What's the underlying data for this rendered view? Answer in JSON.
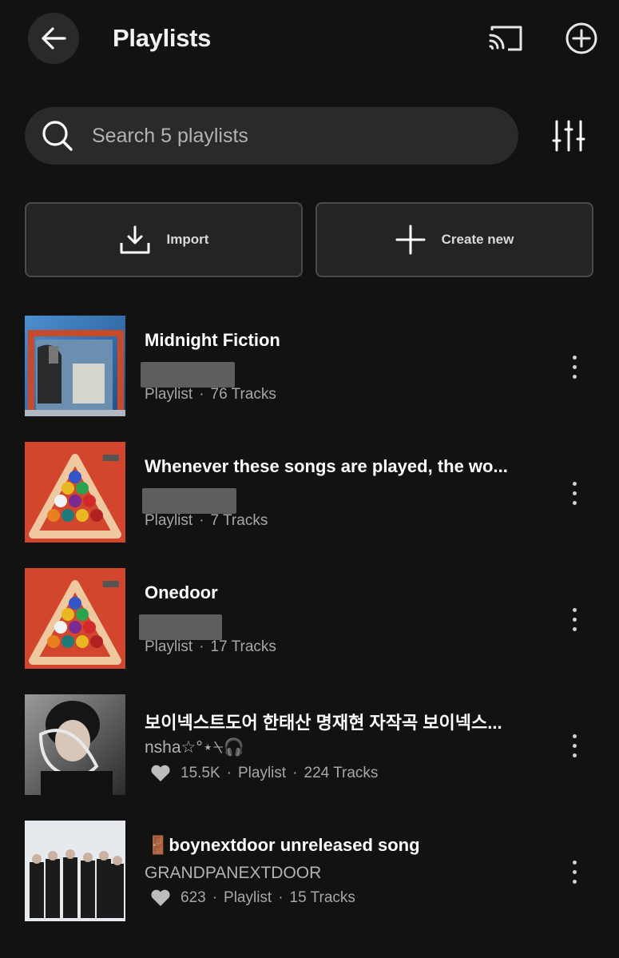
{
  "header": {
    "title": "Playlists",
    "back_icon": "arrow-left-icon",
    "cast_icon": "cast-icon",
    "add_icon": "plus-circle-icon"
  },
  "search": {
    "placeholder": "Search 5 playlists",
    "filter_icon": "sliders-icon"
  },
  "actions": {
    "import_label": "Import",
    "create_label": "Create new"
  },
  "colors": {
    "background": "#121212",
    "surface": "#2a2a2a",
    "text_primary": "#ffffff",
    "text_secondary": "#a7a7a7"
  },
  "playlists": [
    {
      "title": "Midnight Fiction",
      "type": "Playlist",
      "tracks": "76 Tracks"
    },
    {
      "title": "Whenever these songs are played, the wo...",
      "type": "Playlist",
      "tracks": "7 Tracks"
    },
    {
      "title": "Onedoor",
      "type": "Playlist",
      "tracks": "17 Tracks"
    },
    {
      "title": "보이넥스트도어 한태산 명재현 자작곡 보이넥스...",
      "author": "nsha☆°⋆⍀🎧",
      "likes": "15.5K",
      "type": "Playlist",
      "tracks": "224 Tracks"
    },
    {
      "title": "🚪boynextdoor unreleased song",
      "author": "GRANDPANEXTDOOR",
      "likes": "623",
      "type": "Playlist",
      "tracks": "15 Tracks"
    }
  ]
}
